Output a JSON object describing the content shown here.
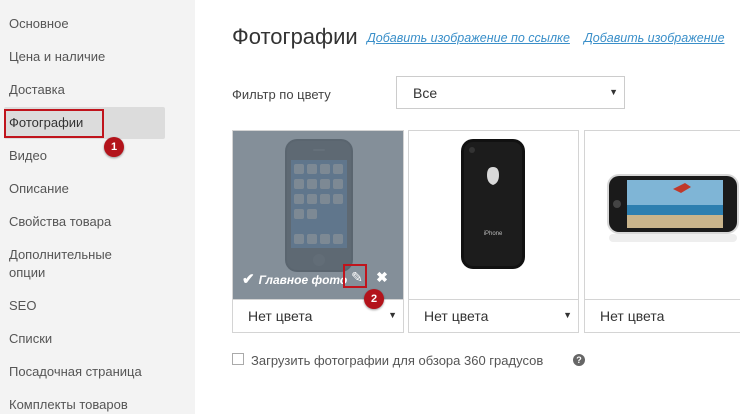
{
  "sidebar": {
    "items": [
      {
        "label": "Основное"
      },
      {
        "label": "Цена и наличие"
      },
      {
        "label": "Доставка"
      },
      {
        "label": "Фотографии"
      },
      {
        "label": "Видео"
      },
      {
        "label": "Описание"
      },
      {
        "label": "Свойства товара"
      },
      {
        "label": "Дополнительные"
      },
      {
        "label": "опции"
      },
      {
        "label": "SEO"
      },
      {
        "label": "Списки"
      },
      {
        "label": "Посадочная страница"
      },
      {
        "label": "Комплекты товаров"
      }
    ],
    "active_index": 3
  },
  "annotations": {
    "badge1": "1",
    "badge2": "2"
  },
  "header": {
    "title": "Фотографии",
    "link_by_url": "Добавить изображение по ссылке",
    "link_add_image": "Добавить изображение"
  },
  "filter": {
    "label": "Фильтр по цвету",
    "selected": "Все"
  },
  "photos": [
    {
      "color": "Нет цвета",
      "main_label": "Главное фото",
      "is_main": true,
      "image": "iphone-front-icon"
    },
    {
      "color": "Нет цвета",
      "is_main": false,
      "image": "iphone-back-icon"
    },
    {
      "color": "Нет цвета",
      "is_main": false,
      "image": "iphone-landscape-icon"
    }
  ],
  "options": {
    "upload_360_label": "Загрузить фотографии для обзора 360 градусов",
    "upload_360_checked": false
  },
  "colors": {
    "accent_link": "#3a8fc9",
    "annotation_red": "#c0141c",
    "overlay": "#697682"
  }
}
